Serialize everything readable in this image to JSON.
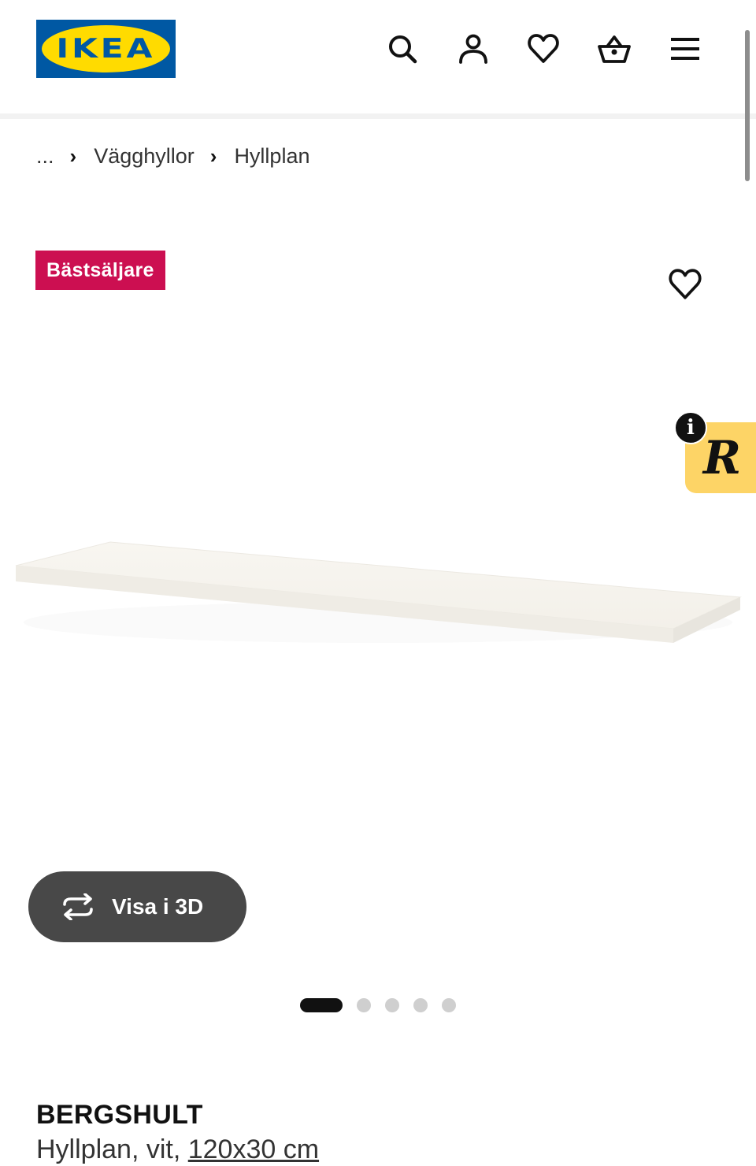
{
  "brand": {
    "logo_text": "IKEA",
    "reg_mark": "®",
    "blue": "#0058a3",
    "yellow": "#ffdb00"
  },
  "header": {
    "icons": [
      "search-icon",
      "user-icon",
      "heart-icon",
      "basket-icon",
      "menu-icon"
    ]
  },
  "breadcrumb": {
    "ellipsis": "...",
    "separator": "›",
    "items": [
      "Vägghyllor",
      "Hyllplan"
    ]
  },
  "badge": {
    "label": "Bästsäljare",
    "color": "#cc0f51"
  },
  "widget": {
    "info_label": "i",
    "logo_letter": "R",
    "color": "#fdd466"
  },
  "gallery": {
    "view_3d_label": "Visa i 3D",
    "slides_total": 5,
    "active_slide": 1
  },
  "product": {
    "name": "BERGSHULT",
    "description_prefix": "Hyllplan, vit, ",
    "size": "120x30 cm"
  }
}
